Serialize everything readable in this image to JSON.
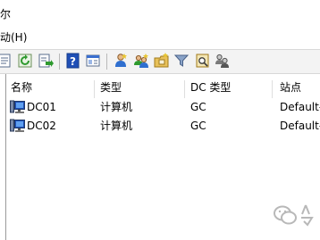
{
  "window": {
    "title_fragment": "尔"
  },
  "menu": {
    "items": [
      {
        "label": "动(H)"
      }
    ]
  },
  "toolbar": {
    "buttons": [
      {
        "name": "properties-icon"
      },
      {
        "name": "refresh-icon"
      },
      {
        "name": "export-list-icon"
      },
      {
        "name": "help-icon"
      },
      {
        "name": "show-hide-pane-icon"
      },
      {
        "name": "user-icon"
      },
      {
        "name": "group-icon"
      },
      {
        "name": "ou-icon"
      },
      {
        "name": "filter-icon"
      },
      {
        "name": "find-icon"
      },
      {
        "name": "group-users-icon"
      }
    ]
  },
  "list": {
    "columns": [
      "名称",
      "类型",
      "DC 类型",
      "站点"
    ],
    "rows": [
      {
        "icon": "computer-icon",
        "name": "DC01",
        "type": "计算机",
        "dc_type": "GC",
        "site": "Default-"
      },
      {
        "icon": "computer-icon",
        "name": "DC02",
        "type": "计算机",
        "dc_type": "GC",
        "site": "Default-"
      }
    ]
  },
  "colors": {
    "toolbar_bg": "#f3f3f3",
    "separator": "#b9b9b9",
    "icon_blue": "#1f4fb6",
    "watermark": "#b8b8b8"
  }
}
